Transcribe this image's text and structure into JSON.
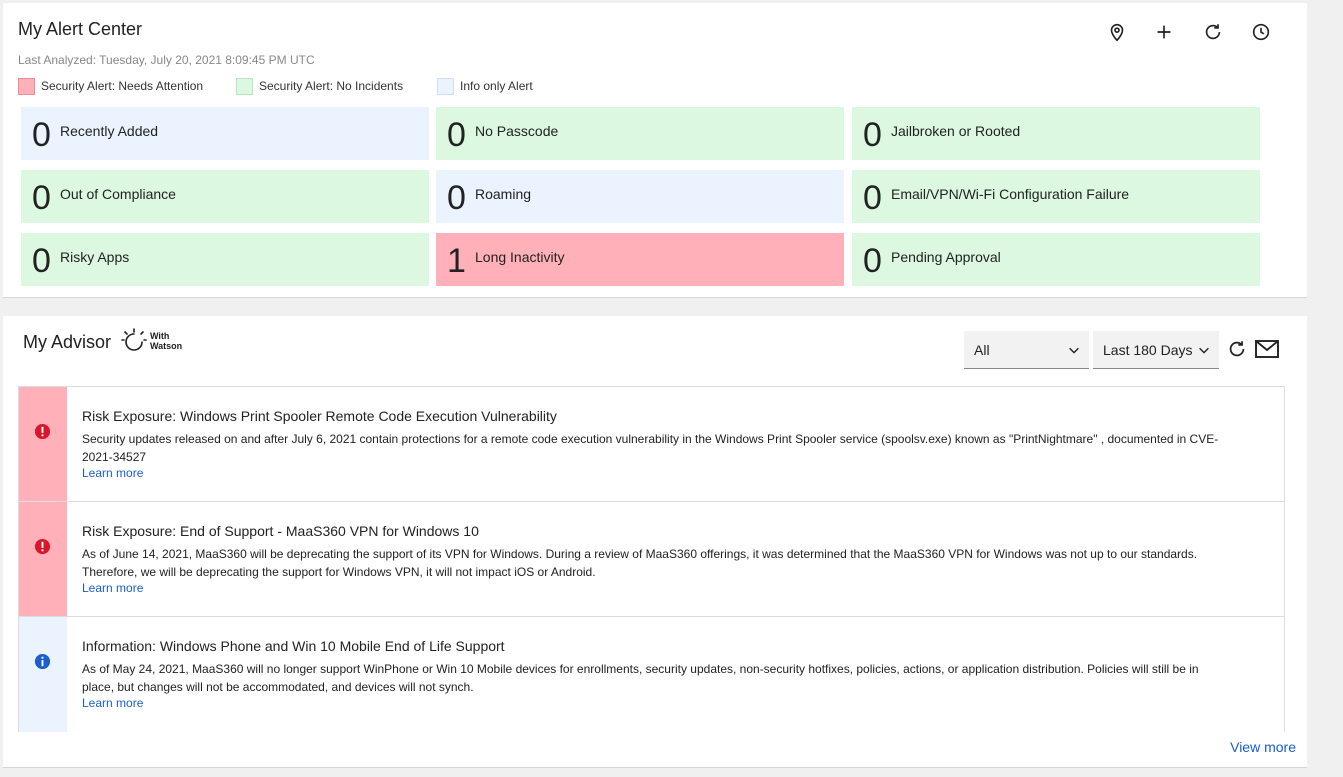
{
  "alert_center": {
    "title": "My Alert Center",
    "last_analyzed": "Last Analyzed: Tuesday, July 20, 2021 8:09:45 PM UTC",
    "toolbar": {
      "icons": [
        "location-pin-icon",
        "plus-icon",
        "refresh-icon",
        "clock-icon"
      ]
    },
    "legend": [
      {
        "label": "Security Alert: Needs Attention",
        "color": "#ffb0b8"
      },
      {
        "label": "Security Alert: No Incidents",
        "color": "#dcf8e1"
      },
      {
        "label": "Info only Alert",
        "color": "#ebf3fe"
      }
    ],
    "tiles": [
      {
        "count": "0",
        "label": "Recently Added",
        "type": "info"
      },
      {
        "count": "0",
        "label": "No Passcode",
        "type": "ok"
      },
      {
        "count": "0",
        "label": "Jailbroken or Rooted",
        "type": "ok"
      },
      {
        "count": "0",
        "label": "Out of Compliance",
        "type": "ok"
      },
      {
        "count": "0",
        "label": "Roaming",
        "type": "info"
      },
      {
        "count": "0",
        "label": "Email/VPN/Wi-Fi Configuration Failure",
        "type": "ok"
      },
      {
        "count": "0",
        "label": "Risky Apps",
        "type": "ok"
      },
      {
        "count": "1",
        "label": "Long Inactivity",
        "type": "attention"
      },
      {
        "count": "0",
        "label": "Pending Approval",
        "type": "ok"
      }
    ]
  },
  "advisor": {
    "title": "My Advisor",
    "watson_line1": "With",
    "watson_line2": "Watson",
    "filter_value": "All",
    "range_value": "Last 180 Days",
    "items": [
      {
        "severity": "attention",
        "icon": "exclamation-icon",
        "title": "Risk Exposure: Windows Print Spooler Remote Code Execution Vulnerability",
        "body": "Security updates released on and after July 6, 2021 contain protections for a remote code execution vulnerability in the Windows Print Spooler service (spoolsv.exe) known as \"PrintNightmare\" , documented in CVE-2021-34527",
        "link": "Learn more"
      },
      {
        "severity": "attention",
        "icon": "exclamation-icon",
        "title": "Risk Exposure: End of Support - MaaS360 VPN for Windows 10",
        "body": "As of June 14, 2021, MaaS360 will be deprecating the support of its VPN for Windows. During a review of MaaS360 offerings, it was determined that the MaaS360 VPN for Windows was not up to our standards. Therefore, we will be deprecating the support for Windows VPN, it will not impact iOS or Android.",
        "link": "Learn more"
      },
      {
        "severity": "info",
        "icon": "info-icon",
        "title": "Information: Windows Phone and Win 10 Mobile End of Life Support",
        "body": "As of May 24, 2021, MaaS360 will no longer support WinPhone or Win 10 Mobile devices for enrollments, security updates, non-security hotfixes, policies, actions, or application distribution. Policies will still be in place, but changes will not be accommodated, and devices will not synch.",
        "link": "Learn more"
      }
    ],
    "view_more": "View more"
  }
}
